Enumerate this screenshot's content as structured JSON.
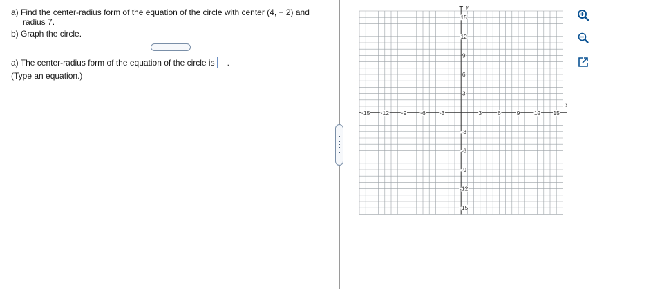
{
  "question": {
    "line1": "a) Find the center-radius form of the equation of the circle with center (4, − 2) and",
    "line2": "radius 7.",
    "line3": "b) Graph the circle."
  },
  "more_button": ".....",
  "answer": {
    "prompt": "a) The center-radius form of the equation of the circle is",
    "suffix": ".",
    "hint": "(Type an equation.)"
  },
  "graph": {
    "x_label": "x",
    "y_label": "y",
    "x_ticks": [
      "-15",
      "-12",
      "-9",
      "-6",
      "-3",
      "3",
      "6",
      "9",
      "12",
      "15"
    ],
    "y_ticks": [
      "15",
      "12",
      "9",
      "6",
      "3",
      "-3",
      "-6",
      "-9",
      "-12",
      "-15"
    ],
    "range": [
      -16,
      16
    ],
    "grid_step": 1,
    "grid_color": "#9aa0a6",
    "axis_color": "#333333"
  },
  "tools": {
    "zoom_in": "zoom-in-icon",
    "zoom_out": "zoom-out-icon",
    "popout": "popout-icon",
    "icon_color": "#0b5394"
  }
}
